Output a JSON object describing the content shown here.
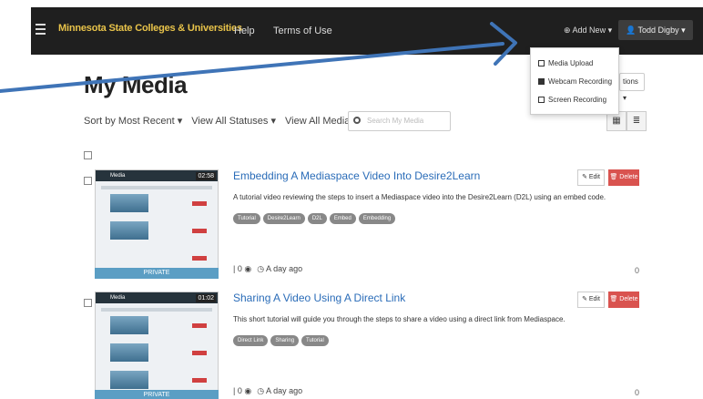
{
  "nav": {
    "brand": "Minnesota State Colleges & Universities",
    "help": "Help",
    "terms": "Terms of Use",
    "add_new": "⊕ Add New ▾",
    "user": "👤 Todd Digby ▾"
  },
  "dropdown": {
    "items": [
      {
        "label": "Media Upload"
      },
      {
        "label": "Webcam Recording"
      },
      {
        "label": "Screen Recording"
      }
    ]
  },
  "page": {
    "title": "My Media",
    "actions": "tions ▾"
  },
  "toolbar": {
    "sort": "Sort by Most Recent ▾",
    "statuses": "View All Statuses ▾",
    "media": "View All Media ▾",
    "search_placeholder": "Search My Media"
  },
  "entries": [
    {
      "title": "Embedding A Mediaspace Video Into Desire2Learn",
      "description": "A tutorial video reviewing the steps to insert a Mediaspace video into the Desire2Learn (D2L) using an embed code.",
      "tags": [
        "Tutorial",
        "Desire2Learn",
        "D2L",
        "Embed",
        "Embedding"
      ],
      "duration": "02:58",
      "status": "PRIVATE",
      "meta_likes": "| 0 ◉",
      "meta_time": "◷ A day ago",
      "count": "0",
      "edit": "✎ Edit",
      "delete": "🗑 Delete"
    },
    {
      "title": "Sharing A Video Using A Direct Link",
      "description": "This short tutorial will guide you through the steps to share a video using a direct link from Mediaspace.",
      "tags": [
        "Direct Link",
        "Sharing",
        "Tutorial"
      ],
      "duration": "01:02",
      "status": "PRIVATE",
      "meta_likes": "| 0 ◉",
      "meta_time": "◷ A day ago",
      "count": "0",
      "edit": "✎ Edit",
      "delete": "🗑 Delete"
    }
  ],
  "colors": {
    "nav_bg": "#1f1f1f",
    "brand": "#e8c34a",
    "link": "#2a6cb8",
    "delete": "#d9534f",
    "arrow": "#3f74b7"
  }
}
